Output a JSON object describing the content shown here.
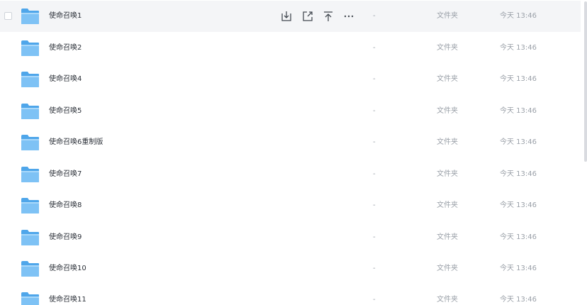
{
  "actions": {
    "download_icon": "download-icon",
    "share_icon": "share-icon",
    "pin_top_icon": "pin-top-icon",
    "more_label": "···"
  },
  "columns": {
    "size": "-",
    "type": "文件夹"
  },
  "rows": [
    {
      "name": "使命召唤1",
      "size": "-",
      "type": "文件夹",
      "time": "今天 13:46",
      "hovered": true
    },
    {
      "name": "使命召唤2",
      "size": "-",
      "type": "文件夹",
      "time": "今天 13:46"
    },
    {
      "name": "使命召唤4",
      "size": "-",
      "type": "文件夹",
      "time": "今天 13:46"
    },
    {
      "name": "使命召唤5",
      "size": "-",
      "type": "文件夹",
      "time": "今天 13:46"
    },
    {
      "name": "使命召唤6重制版",
      "size": "-",
      "type": "文件夹",
      "time": "今天 13:46"
    },
    {
      "name": "使命召唤7",
      "size": "-",
      "type": "文件夹",
      "time": "今天 13:46"
    },
    {
      "name": "使命召唤8",
      "size": "-",
      "type": "文件夹",
      "time": "今天 13:46"
    },
    {
      "name": "使命召唤9",
      "size": "-",
      "type": "文件夹",
      "time": "今天 13:46"
    },
    {
      "name": "使命召唤10",
      "size": "-",
      "type": "文件夹",
      "time": "今天 13:46"
    },
    {
      "name": "使命召唤11",
      "size": "-",
      "type": "文件夹",
      "time": "今天 13:46"
    }
  ],
  "colors": {
    "hover_background": "#f4f5f7",
    "folder_primary": "#5aaef0",
    "folder_light": "#8ccbf7",
    "text_primary": "#2b3038",
    "text_secondary": "#9aa0a8"
  }
}
